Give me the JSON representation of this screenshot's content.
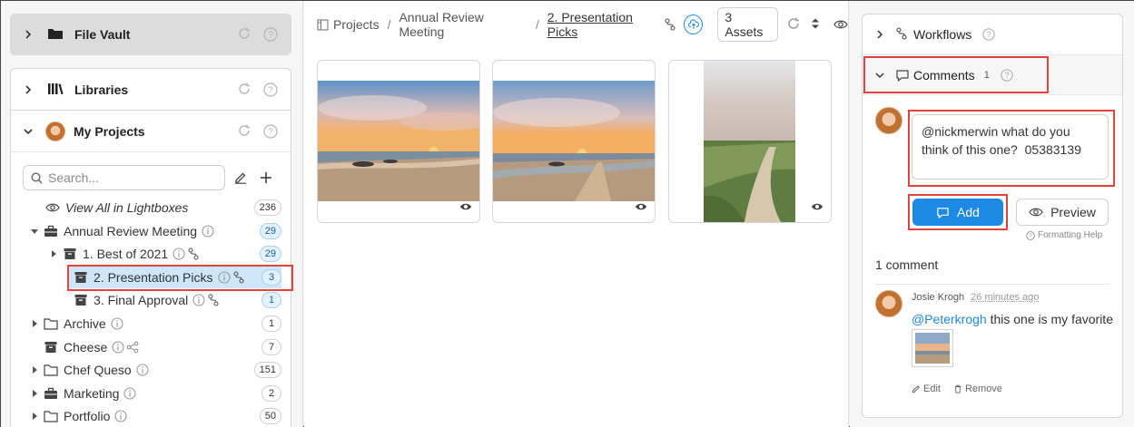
{
  "left": {
    "file_vault": {
      "title": "File Vault"
    },
    "libraries": {
      "title": "Libraries"
    },
    "my_projects": {
      "title": "My Projects"
    },
    "search": {
      "placeholder": "Search..."
    },
    "tree": [
      {
        "label": "View All in Lightboxes",
        "count": "236"
      },
      {
        "label": "Annual Review Meeting",
        "count": "29"
      },
      {
        "label": "1. Best of 2021",
        "count": "29"
      },
      {
        "label": "2. Presentation Picks",
        "count": "3"
      },
      {
        "label": "3. Final Approval",
        "count": "1"
      },
      {
        "label": "Archive",
        "count": "1"
      },
      {
        "label": "Cheese",
        "count": "7"
      },
      {
        "label": "Chef Queso",
        "count": "151"
      },
      {
        "label": "Marketing",
        "count": "2"
      },
      {
        "label": "Portfolio",
        "count": "50"
      }
    ]
  },
  "breadcrumb": {
    "items": [
      "Projects",
      "Annual Review Meeting",
      "2. Presentation Picks"
    ],
    "separator": "/",
    "assets": "3 Assets"
  },
  "right": {
    "workflows": {
      "title": "Workflows"
    },
    "comments": {
      "title": "Comments",
      "count": "1"
    },
    "input_value": "@nickmerwin what do you think of this one?  05383139",
    "add_label": "Add",
    "preview_label": "Preview",
    "formatting_help": "Formatting Help",
    "comment_count": "1 comment",
    "comment": {
      "author": "Josie Krogh",
      "time": "26 minutes ago",
      "mention": "@Peterkrogh",
      "text": " this one is my favorite",
      "edit": "Edit",
      "remove": "Remove"
    }
  },
  "colors": {
    "accent": "#1e88e5",
    "highlight": "#e0443a",
    "selected": "#cde6fa"
  }
}
